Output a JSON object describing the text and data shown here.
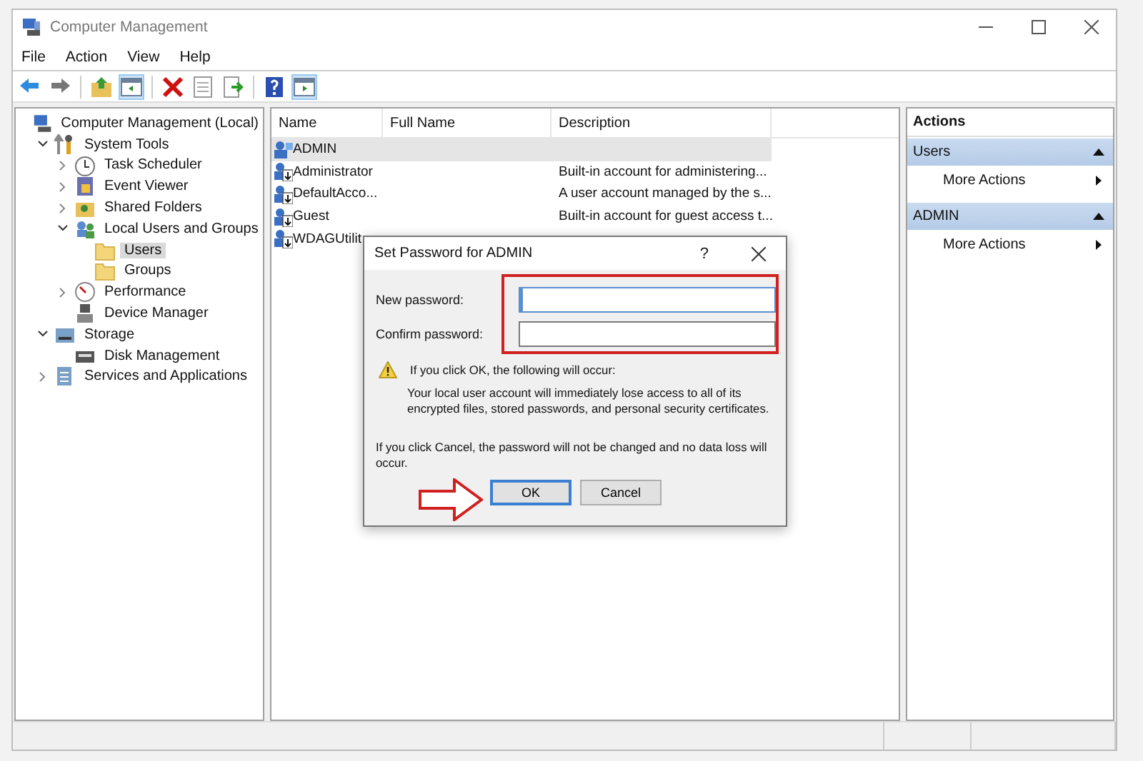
{
  "window": {
    "title": "Computer Management"
  },
  "menu": [
    "File",
    "Action",
    "View",
    "Help"
  ],
  "toolbar": [
    {
      "kind": "back"
    },
    {
      "kind": "forward"
    },
    {
      "kind": "separator"
    },
    {
      "kind": "up"
    },
    {
      "kind": "tree-toggle",
      "on": true
    },
    {
      "kind": "separator"
    },
    {
      "kind": "delete"
    },
    {
      "kind": "properties"
    },
    {
      "kind": "export"
    },
    {
      "kind": "separator"
    },
    {
      "kind": "help"
    },
    {
      "kind": "pane-toggle",
      "on": true
    }
  ],
  "tree": [
    {
      "label": "Computer Management (Local)",
      "kind": "computer",
      "selected": false,
      "children": [
        {
          "label": "System Tools",
          "kind": "tools",
          "expanded": true,
          "selected": false,
          "children": [
            {
              "label": "Task Scheduler",
              "kind": "clock",
              "expanded": false,
              "selected": false
            },
            {
              "label": "Event Viewer",
              "kind": "log",
              "expanded": false,
              "selected": false
            },
            {
              "label": "Shared Folders",
              "kind": "share",
              "expanded": false,
              "selected": false
            },
            {
              "label": "Local Users and Groups",
              "kind": "users",
              "expanded": true,
              "selected": false,
              "children": [
                {
                  "label": "Users",
                  "kind": "folder",
                  "selected": true
                },
                {
                  "label": "Groups",
                  "kind": "folder",
                  "selected": false
                }
              ]
            },
            {
              "label": "Performance",
              "kind": "gauge",
              "expanded": false,
              "selected": false
            },
            {
              "label": "Device Manager",
              "kind": "device",
              "selected": false
            }
          ]
        },
        {
          "label": "Storage",
          "kind": "storage",
          "expanded": true,
          "selected": false,
          "children": [
            {
              "label": "Disk Management",
              "kind": "disk",
              "selected": false
            }
          ]
        },
        {
          "label": "Services and Applications",
          "kind": "services",
          "expanded": false,
          "selected": false
        }
      ]
    }
  ],
  "list": {
    "columns": [
      "Name",
      "Full Name",
      "Description"
    ],
    "rows": [
      {
        "name": "ADMIN",
        "disabled": false,
        "selected": true
      },
      {
        "name": "Administrator",
        "description": "Built-in account for administering...",
        "disabled": true,
        "selected": false
      },
      {
        "name": "DefaultAcco...",
        "description": "A user account managed by the s...",
        "disabled": true,
        "selected": false
      },
      {
        "name": "Guest",
        "description": "Built-in account for guest access t...",
        "disabled": true,
        "selected": false
      },
      {
        "name": "WDAGUtilit",
        "disabled": true,
        "selected": false
      }
    ]
  },
  "actions": {
    "title": "Actions",
    "sections": [
      {
        "title": "Users",
        "expanded": true,
        "items": [
          "More Actions"
        ]
      },
      {
        "title": "ADMIN",
        "expanded": true,
        "items": [
          "More Actions"
        ]
      }
    ]
  },
  "dialog": {
    "title": "Set Password for ADMIN",
    "help": "?",
    "fields": [
      {
        "label": "New password:",
        "focused": true
      },
      {
        "label": "Confirm password:",
        "focused": false
      }
    ],
    "warning": "If you click OK, the following will occur:",
    "warning_detail": "Your local user account will immediately lose access to all of its encrypted files, stored passwords, and personal security certificates.",
    "cancel_note": "If you click Cancel, the password will not be changed and no data loss will occur.",
    "buttons": [
      {
        "label": "OK",
        "default": true
      },
      {
        "label": "Cancel",
        "default": false
      }
    ]
  },
  "annotations": {
    "highlight_box": true,
    "arrow": true
  }
}
